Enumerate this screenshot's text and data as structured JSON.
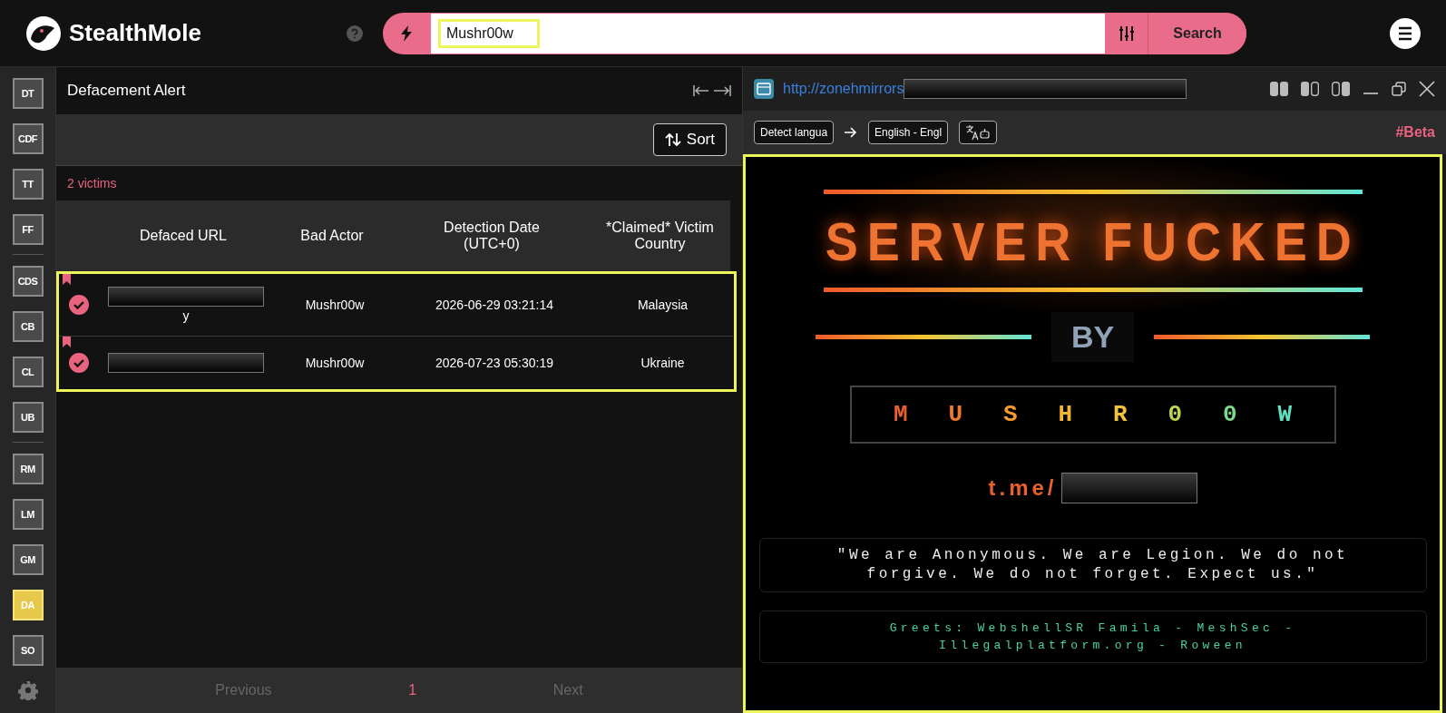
{
  "header": {
    "logo": "StealthMole",
    "search_value": "Mushr00w",
    "search_button": "Search"
  },
  "sidebar": {
    "groups": [
      [
        {
          "label": "DT",
          "selected": false
        },
        {
          "label": "CDF",
          "selected": false
        },
        {
          "label": "TT",
          "selected": false
        },
        {
          "label": "FF",
          "selected": false
        }
      ],
      [
        {
          "label": "CDS",
          "selected": false
        },
        {
          "label": "CB",
          "selected": false
        },
        {
          "label": "CL",
          "selected": false
        },
        {
          "label": "UB",
          "selected": false
        }
      ],
      [
        {
          "label": "RM",
          "selected": false
        },
        {
          "label": "LM",
          "selected": false
        },
        {
          "label": "GM",
          "selected": false
        },
        {
          "label": "DA",
          "selected": true
        },
        {
          "label": "SO",
          "selected": false
        }
      ]
    ]
  },
  "panel": {
    "title": "Defacement Alert",
    "sort": "Sort",
    "count": "2 victims",
    "columns": [
      "Defaced URL",
      "Bad Actor",
      "Detection Date\n(UTC+0)",
      "*Claimed* Victim\nCountry"
    ],
    "rows": [
      {
        "bookmarked": true,
        "checked": true,
        "url_tail": "y",
        "bad_actor": "Mushr00w",
        "date": "2026-06-29 03:21:14",
        "country": "Malaysia"
      },
      {
        "bookmarked": true,
        "checked": true,
        "bad_actor": "Mushr00w",
        "date": "2026-07-23 05:30:19",
        "country": "Ukraine"
      }
    ],
    "pagination": {
      "previous": "Previous",
      "page": "1",
      "next": "Next"
    }
  },
  "viewer": {
    "url": "http://zonehmirrors",
    "source_lang": "Detect langua",
    "target_lang": "English - Engl",
    "beta": "#Beta",
    "page": {
      "headline": "SERVER FUCKED",
      "by": "BY",
      "name_letters": [
        {
          "char": "M",
          "color": "#e8612c"
        },
        {
          "char": "U",
          "color": "#ee7a2a"
        },
        {
          "char": "S",
          "color": "#f39b2e"
        },
        {
          "char": "H",
          "color": "#f5b531"
        },
        {
          "char": "R",
          "color": "#f2c23a"
        },
        {
          "char": "0",
          "color": "#bcd64f"
        },
        {
          "char": "0",
          "color": "#7bd98a"
        },
        {
          "char": "W",
          "color": "#5fe0c0"
        }
      ],
      "link_prefix": "t.me/",
      "quote": "\"We are Anonymous. We are Legion. We do not forgive. We do not forget. Expect us.\"",
      "greets": "Greets: WebshellSR Famila - MeshSec - Illegalplatform.org - Roween"
    }
  }
}
